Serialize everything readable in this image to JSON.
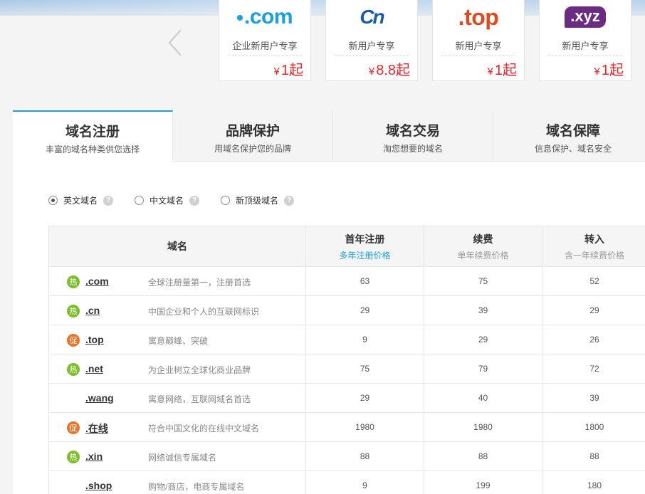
{
  "promos": [
    {
      "logo": ".com",
      "desc": "企业新用户专享",
      "currency": "¥",
      "price": "1起"
    },
    {
      "logo": "Cn",
      "desc": "新用户专享",
      "currency": "¥",
      "price": "8.8起"
    },
    {
      "logo": ".top",
      "desc": "新用户专享",
      "currency": "¥",
      "price": "1起"
    },
    {
      "logo": ".xyz",
      "desc": "新用户专享",
      "currency": "¥",
      "price": "1起"
    }
  ],
  "tabs": [
    {
      "title": "域名注册",
      "desc": "丰富的域名种类供您选择"
    },
    {
      "title": "品牌保护",
      "desc": "用域名保护您的品牌"
    },
    {
      "title": "域名交易",
      "desc": "淘您想要的域名"
    },
    {
      "title": "域名保障",
      "desc": "信息保护、域名安全"
    }
  ],
  "filters": {
    "options": [
      "英文域名",
      "中文域名",
      "新顶级域名"
    ],
    "selected": "英文域名",
    "help_glyph": "?"
  },
  "table": {
    "headers": [
      {
        "title": "域名",
        "sub": ""
      },
      {
        "title": "首年注册",
        "sub": "多年注册价格"
      },
      {
        "title": "续费",
        "sub": "单年续费价格"
      },
      {
        "title": "转入",
        "sub": "含一年续费价格"
      }
    ],
    "rows": [
      {
        "badge": "热",
        "name": ".com",
        "desc": "全球注册量第一，注册首选",
        "first": "63",
        "renew": "75",
        "transfer": "52"
      },
      {
        "badge": "热",
        "name": ".cn",
        "desc": "中国企业和个人的互联网标识",
        "first": "29",
        "renew": "39",
        "transfer": "29"
      },
      {
        "badge": "促",
        "name": ".top",
        "desc": "寓意巅峰、突破",
        "first": "9",
        "renew": "29",
        "transfer": "26"
      },
      {
        "badge": "热",
        "name": ".net",
        "desc": "为企业树立全球化商业品牌",
        "first": "75",
        "renew": "79",
        "transfer": "72"
      },
      {
        "badge": "",
        "name": ".wang",
        "desc": "寓意网络，互联网域名首选",
        "first": "29",
        "renew": "40",
        "transfer": "39"
      },
      {
        "badge": "促",
        "name": ".在线",
        "desc": "符合中国文化的在线中文域名",
        "first": "1980",
        "renew": "1980",
        "transfer": "1800"
      },
      {
        "badge": "热",
        "name": ".xin",
        "desc": "网络诚信专属域名",
        "first": "88",
        "renew": "88",
        "transfer": "88"
      },
      {
        "badge": "",
        "name": ".shop",
        "desc": "购物/商店，电商专属域名",
        "first": "9",
        "renew": "199",
        "transfer": "180"
      }
    ]
  },
  "colors": {
    "accent": "#1aa0dc",
    "price": "#e4252b",
    "hot": "#7cbf2a",
    "promo": "#e8742a"
  }
}
